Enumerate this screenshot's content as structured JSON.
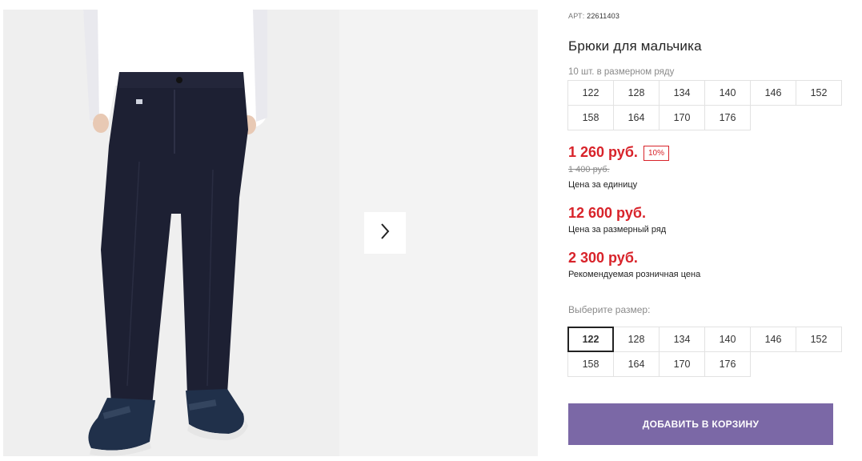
{
  "product": {
    "sku_label": "АРТ:",
    "sku_value": "22611403",
    "title": "Брюки для мальчика",
    "pack_info": "10 шт. в размерном ряду"
  },
  "size_range": [
    "122",
    "128",
    "134",
    "140",
    "146",
    "152",
    "158",
    "164",
    "170",
    "176"
  ],
  "pricing": {
    "unit_price": "1 260 руб.",
    "discount_badge": "10%",
    "old_price": "1 400 руб.",
    "unit_price_label": "Цена за единицу",
    "range_price": "12 600 руб.",
    "range_price_label": "Цена за размерный ряд",
    "retail_price": "2 300 руб.",
    "retail_price_label": "Рекомендуемая розничная цена"
  },
  "size_select": {
    "label": "Выберите размер:",
    "sizes": [
      "122",
      "128",
      "134",
      "140",
      "146",
      "152",
      "158",
      "164",
      "170",
      "176"
    ],
    "selected": "122"
  },
  "cart": {
    "add_label": "ДОБАВИТЬ В КОРЗИНУ"
  },
  "gallery": {
    "next_icon": "chevron-right-icon"
  },
  "colors": {
    "accent_red": "#d8232a",
    "button_purple": "#7b68a6"
  }
}
